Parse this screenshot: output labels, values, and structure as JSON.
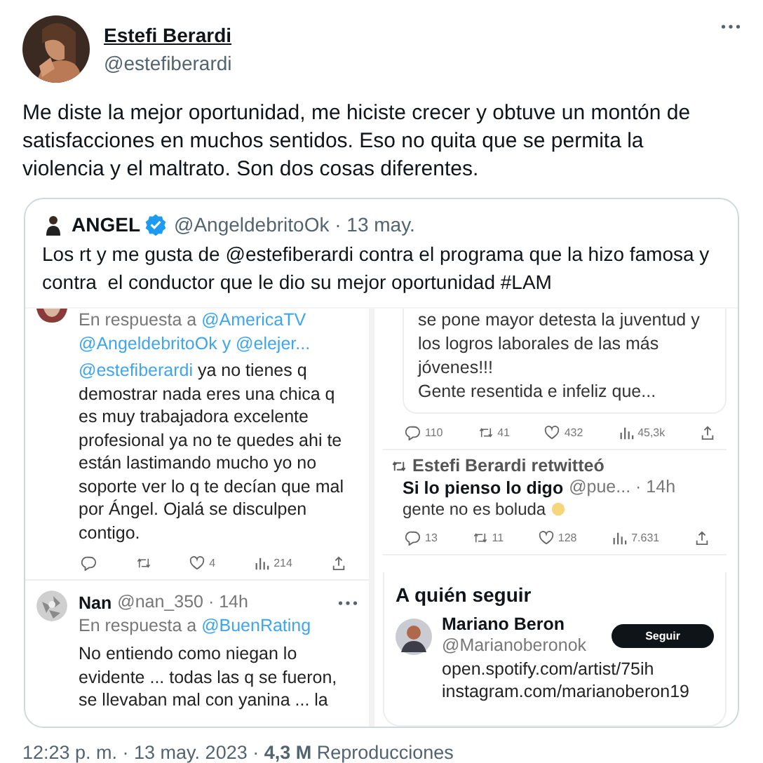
{
  "tweet": {
    "author": {
      "name": "Estefi Berardi",
      "handle": "@estefiberardi"
    },
    "text": "Me diste la mejor oportunidad, me hiciste crecer y obtuve un montón de satisfacciones en muchos sentidos. Eso no quita que se permita la violencia y el maltrato. Son dos cosas diferentes.",
    "quote": {
      "author": {
        "name": "ANGEL",
        "verified": true,
        "handle": "@AngeldebritoOk · 13 may."
      },
      "text": "Los rt y me gusta de @estefiberardi contra el programa que la hizo famosa y contra  el conductor que le dio su mejor oportunidad #LAM",
      "media": {
        "left": [
          {
            "kind": "reply",
            "reply_prefix": "En respuesta a",
            "reply_to": "@AmericaTV",
            "mentions": "@AngeldebritoOk y @elejer...",
            "mention": "@estefiberardi",
            "text": "ya no tienes q demostrar nada eres una chica q es muy trabajadora  excelente profesional ya no  te quedes ahi te están lastimando mucho yo no soporte ver lo q te decían que mal por Ángel. Ojalá se disculpen contigo.",
            "actions": [
              {
                "kind": "reply"
              },
              {
                "kind": "retweet"
              },
              {
                "kind": "like",
                "count": "4"
              },
              {
                "kind": "views",
                "count": "214"
              },
              {
                "kind": "share"
              }
            ]
          },
          {
            "kind": "tweet",
            "name": "Nan",
            "handle": "@nan_350 · 14h",
            "reply_prefix": "En respuesta a",
            "reply_to": "@BuenRating",
            "text": "No entiendo como niegan lo evidente ... todas las q se fueron, se llevaban mal con yanina ... la"
          }
        ],
        "right": {
          "snippet": "se pone mayor detesta la juventud y los logros laborales de las más jóvenes!!!\nGente resentida e infeliz que...",
          "snippet_actions": [
            {
              "kind": "reply",
              "count": "110"
            },
            {
              "kind": "retweet",
              "count": "41"
            },
            {
              "kind": "like",
              "count": "432"
            },
            {
              "kind": "views",
              "count": "45,3k"
            },
            {
              "kind": "share"
            }
          ],
          "retweet": {
            "label": "Estefi Berardi retwitteó",
            "name": "Si lo pienso lo digo",
            "handle": "@pue... · 14h",
            "text": "gente no es boluda",
            "actions": [
              {
                "kind": "reply",
                "count": "13"
              },
              {
                "kind": "retweet",
                "count": "11"
              },
              {
                "kind": "like",
                "count": "128"
              },
              {
                "kind": "views",
                "count": "7.631"
              },
              {
                "kind": "share"
              }
            ]
          },
          "follow": {
            "heading": "A quién seguir",
            "name": "Mariano Beron",
            "handle": "@Marianoberonok",
            "button": "Seguir",
            "bio": [
              "open.spotify.com/artist/75ih",
              "instagram.com/marianoberon19"
            ]
          }
        }
      }
    },
    "footer": "12:23 p. m. · 13 may. 2023 · **4,3 M** Reproducciones"
  }
}
